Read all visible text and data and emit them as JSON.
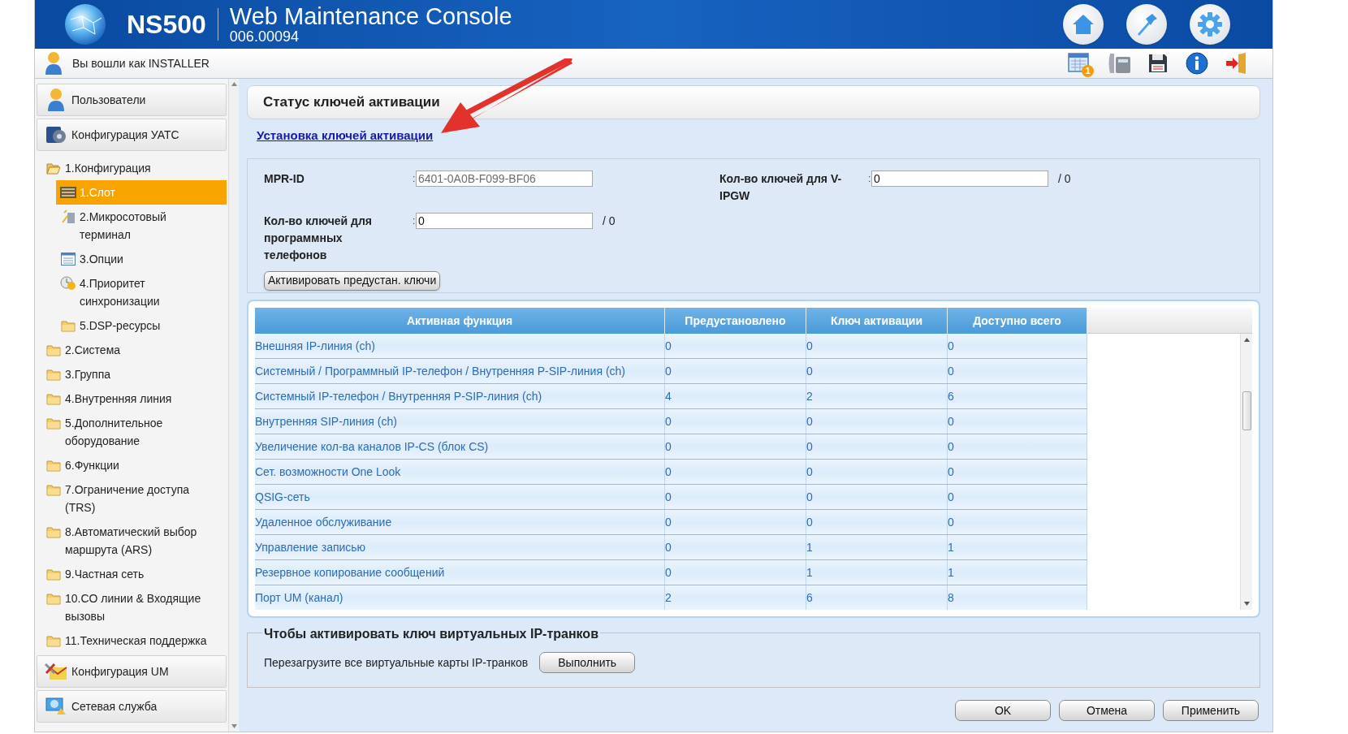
{
  "header": {
    "product": "NS500",
    "title": "Web Maintenance Console",
    "version": "006.00094"
  },
  "user_bar": {
    "login_text": "Вы вошли как INSTALLER",
    "notification_badge": "1"
  },
  "sidebar": {
    "panels_top": [
      {
        "label": "Пользователи",
        "kind": "users"
      },
      {
        "label": "Конфигурация УАТС",
        "kind": "pbx"
      }
    ],
    "tree": [
      {
        "label": "1.Конфигурация",
        "kind": "folder",
        "expanded": true,
        "selected": false,
        "children": [
          {
            "label": "1.Слот",
            "kind": "slot",
            "selected": true
          },
          {
            "label": "2.Микросотовый терминал",
            "kind": "terminal",
            "selected": false
          },
          {
            "label": "3.Опции",
            "kind": "options",
            "selected": false
          },
          {
            "label": "4.Приоритет синхронизации",
            "kind": "sync",
            "selected": false
          },
          {
            "label": "5.DSP-ресурсы",
            "kind": "folder",
            "expanded": false,
            "selected": false
          }
        ]
      },
      {
        "label": "2.Система",
        "kind": "folder",
        "expanded": false,
        "selected": false
      },
      {
        "label": "3.Группа",
        "kind": "folder",
        "expanded": false,
        "selected": false
      },
      {
        "label": "4.Внутренняя линия",
        "kind": "folder",
        "expanded": false,
        "selected": false
      },
      {
        "label": "5.Дополнительное оборудование",
        "kind": "folder",
        "expanded": false,
        "selected": false
      },
      {
        "label": "6.Функции",
        "kind": "folder",
        "expanded": false,
        "selected": false
      },
      {
        "label": "7.Ограничение доступа (TRS)",
        "kind": "folder",
        "expanded": false,
        "selected": false
      },
      {
        "label": "8.Автоматический выбор маршрута (ARS)",
        "kind": "folder",
        "expanded": false,
        "selected": false
      },
      {
        "label": "9.Частная сеть",
        "kind": "folder",
        "expanded": false,
        "selected": false
      },
      {
        "label": "10.CO линии & Входящие вызовы",
        "kind": "folder",
        "expanded": false,
        "selected": false
      },
      {
        "label": "11.Техническая поддержка",
        "kind": "folder",
        "expanded": false,
        "selected": false
      }
    ],
    "panels_bottom": [
      {
        "label": "Конфигурация UM",
        "kind": "um"
      },
      {
        "label": "Сетевая служба",
        "kind": "network"
      }
    ]
  },
  "page": {
    "title": "Статус ключей активации",
    "link": "Установка ключей активации"
  },
  "form": {
    "separator": ":",
    "fields": [
      {
        "label": "MPR-ID",
        "value": "6401-0A0B-F099-BF06",
        "disabled": true
      },
      {
        "label": "Кол-во ключей для V-IPGW",
        "value": "0",
        "suffix": "/ 0",
        "disabled": false
      },
      {
        "label": "Кол-во ключей для программных телефонов",
        "value": "0",
        "suffix": "/ 0",
        "disabled": false
      }
    ],
    "button": "Активировать предустан. ключи"
  },
  "table": {
    "columns": [
      "Активная функция",
      "Предустановлено",
      "Ключ активации",
      "Доступно всего"
    ],
    "rows": [
      [
        "Внешняя IP-линия (ch)",
        "0",
        "0",
        "0"
      ],
      [
        "Системный / Программный IP-телефон / Внутренняя P-SIP-линия (ch)",
        "0",
        "0",
        "0"
      ],
      [
        "Системный IP-телефон /  Внутренняя P-SIP-линия (ch)",
        "4",
        "2",
        "6"
      ],
      [
        "Внутренняя SIP-линия (ch)",
        "0",
        "0",
        "0"
      ],
      [
        "Увеличение кол-ва каналов IP-CS (блок CS)",
        "0",
        "0",
        "0"
      ],
      [
        "Сет. возможности One Look",
        "0",
        "0",
        "0"
      ],
      [
        "QSIG-сеть",
        "0",
        "0",
        "0"
      ],
      [
        "Удаленное обслуживание",
        "0",
        "0",
        "0"
      ],
      [
        "Управление записью",
        "0",
        "1",
        "1"
      ],
      [
        "Резервное копирование сообщений",
        "0",
        "1",
        "1"
      ],
      [
        "Порт UM (канал)",
        "2",
        "6",
        "8"
      ]
    ]
  },
  "virtual_trunks": {
    "legend": "Чтобы активировать ключ виртуальных IP-транков",
    "text": "Перезагрузите все виртуальные карты IP-транков",
    "button": "Выполнить"
  },
  "footer_buttons": [
    "OK",
    "Отмена",
    "Применить"
  ]
}
